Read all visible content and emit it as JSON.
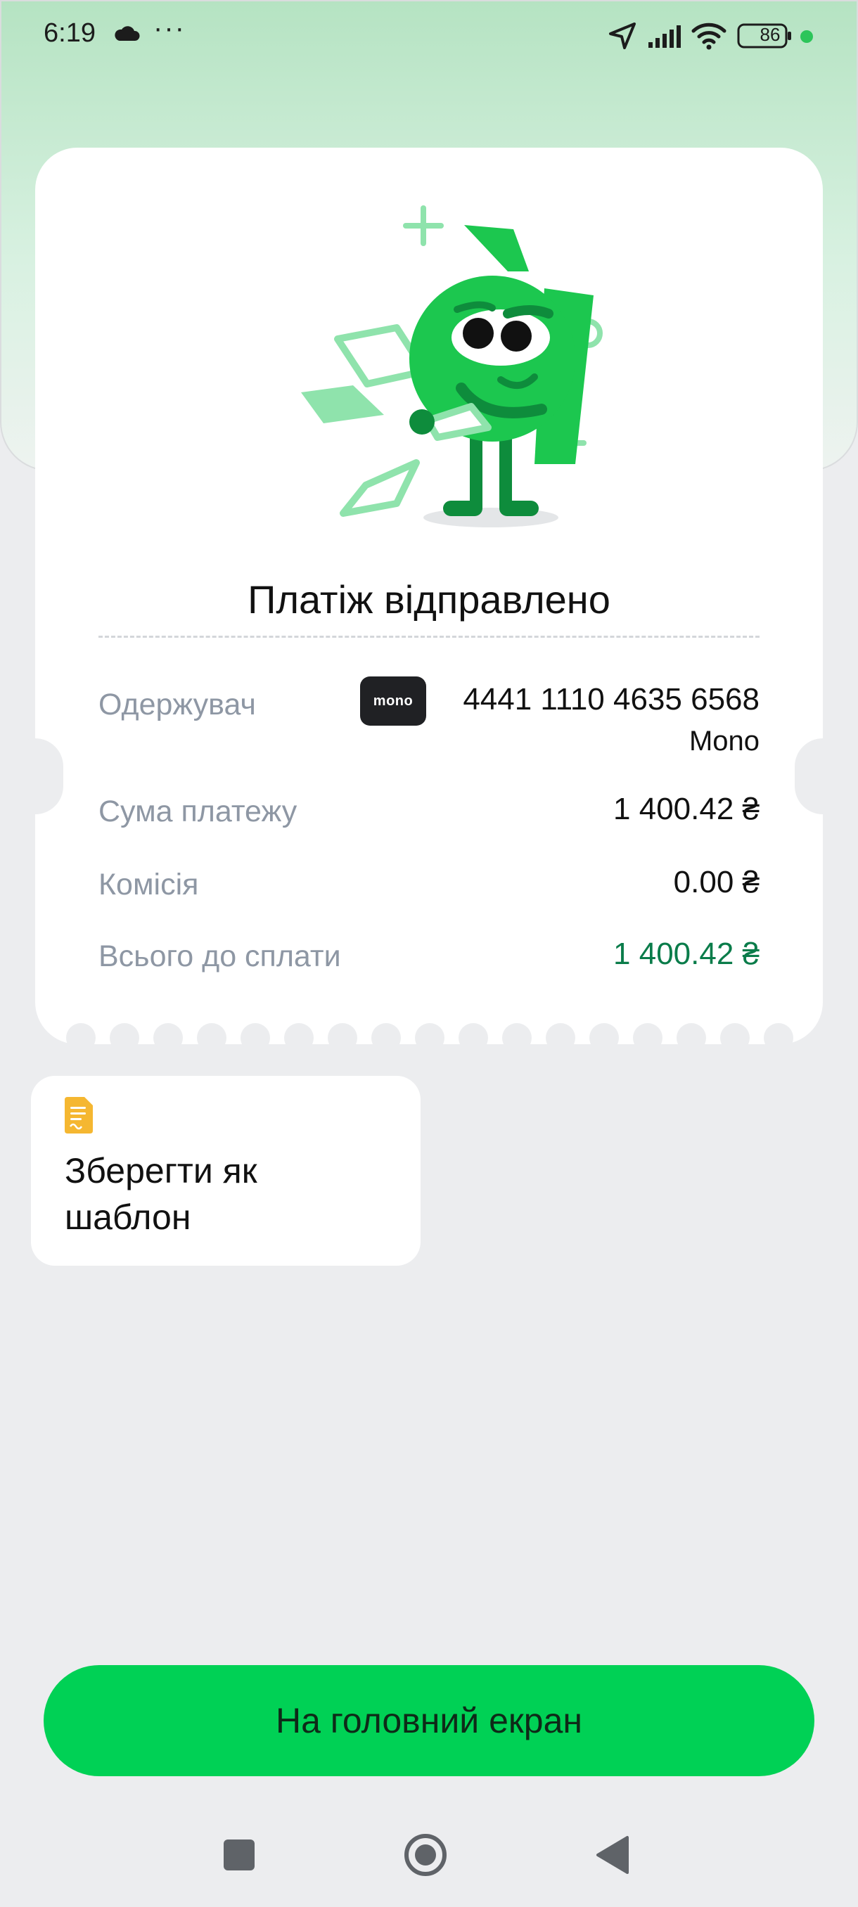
{
  "status_bar": {
    "time": "6:19",
    "more": "···",
    "battery": "86"
  },
  "receipt": {
    "title": "Платіж відправлено",
    "recipient_label": "Одержувач",
    "recipient_badge": "mono",
    "recipient_card": "4441 1110 4635 6568",
    "recipient_bank": "Mono",
    "amount_label": "Сума платежу",
    "amount_value": "1 400.42 ₴",
    "fee_label": "Комісія",
    "fee_value": "0.00 ₴",
    "total_label": "Всього до сплати",
    "total_value": "1 400.42 ₴"
  },
  "template": {
    "label": "Зберегти як шаблон"
  },
  "home_button": {
    "label": "На головний екран"
  },
  "colors": {
    "accent_green": "#00D155",
    "total_green": "#0A7C4A",
    "background": "#ECEDEF"
  },
  "icons": [
    "cloud-icon",
    "location-arrow-icon",
    "signal-icon",
    "wifi-icon",
    "battery-icon",
    "document-icon",
    "square-nav-icon",
    "home-circle-nav-icon",
    "back-triangle-nav-icon"
  ]
}
